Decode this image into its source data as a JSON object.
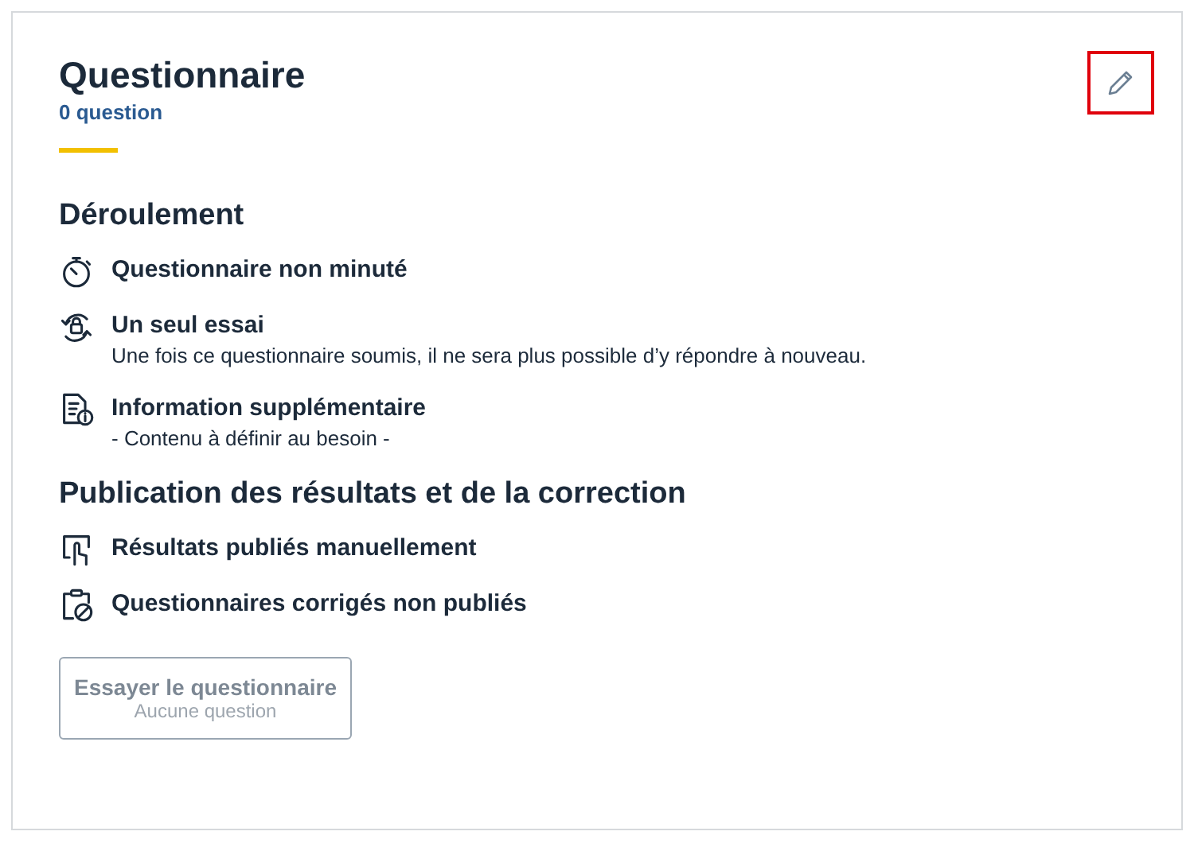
{
  "card": {
    "title": "Questionnaire",
    "subtitle": "0 question",
    "edit_button": {
      "highlighted": true
    },
    "sections": [
      {
        "heading": "Déroulement",
        "items": [
          {
            "kind": "timer",
            "label": "Questionnaire non minuté"
          },
          {
            "kind": "attempt",
            "label": "Un seul essai",
            "description": "Une fois ce questionnaire soumis, il ne sera plus possible d’y répondre à nouveau."
          },
          {
            "kind": "info",
            "label": "Information supplémentaire",
            "description": "- Contenu à définir au besoin -"
          }
        ]
      },
      {
        "heading": "Publication des résultats et de la correction",
        "items": [
          {
            "kind": "manual",
            "label": "Résultats publiés manuellement"
          },
          {
            "kind": "unpublished",
            "label": "Questionnaires corrigés non publiés"
          }
        ]
      }
    ],
    "try_button": {
      "label": "Essayer le questionnaire",
      "sublabel": "Aucune question",
      "disabled": true
    }
  }
}
